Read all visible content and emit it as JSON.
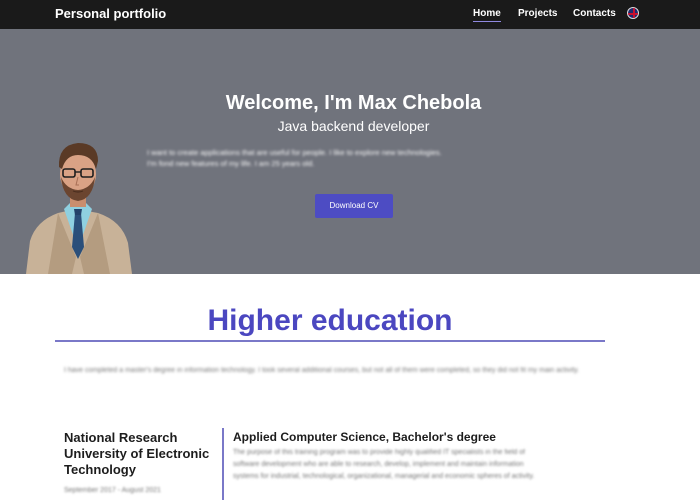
{
  "navbar": {
    "brand": "Personal portfolio",
    "links": [
      {
        "label": "Home",
        "active": true
      },
      {
        "label": "Projects",
        "active": false
      },
      {
        "label": "Contacts",
        "active": false
      }
    ],
    "language_icon": "uk-flag-icon"
  },
  "hero": {
    "title": "Welcome, I'm Max Chebola",
    "subtitle": "Java backend developer",
    "blurred_text": "I want to create applications that are useful for people. I like to explore new technologies. I'm fond new features of my life. I am 25 years old.",
    "button_label": "Download CV",
    "background": "#70737c"
  },
  "education": {
    "title": "Higher education",
    "blurred_intro": "I have completed a master's degree in information technology. I took several additional courses, but not all of them were completed, so they did not fit my main activity.",
    "entry": {
      "university": "National Research University of Electronic Technology",
      "dates_blurred": "September 2017 - August 2021",
      "degree": "Applied Computer Science, Bachelor's degree",
      "description_blurred": "The purpose of this training program was to provide highly qualified IT specialists in the field of software development who are able to research, develop, implement and maintain information systems for industrial, technological, organizational, managerial and economic spheres of activity."
    }
  },
  "colors": {
    "accent": "#4b47c0",
    "button": "#4d4cc3",
    "navbar": "#1a1a1a"
  }
}
